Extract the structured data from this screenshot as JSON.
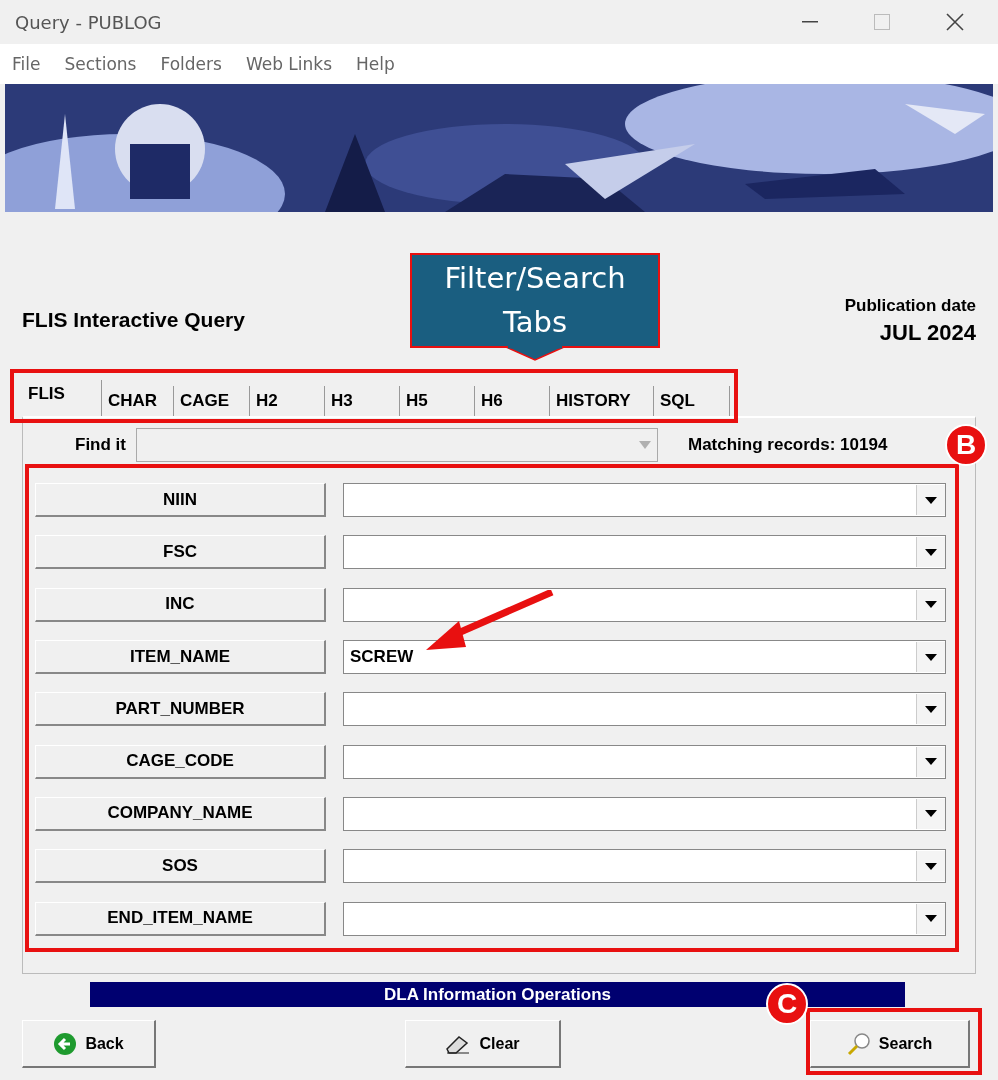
{
  "window": {
    "title": "Query - PUBLOG"
  },
  "menu": [
    "File",
    "Sections",
    "Folders",
    "Web Links",
    "Help"
  ],
  "heading": "FLIS Interactive Query",
  "publication": {
    "label": "Publication date",
    "date": "JUL 2024"
  },
  "tabs": [
    {
      "label": "FLIS",
      "selected": true
    },
    {
      "label": "CHAR",
      "selected": false
    },
    {
      "label": "CAGE",
      "selected": false
    },
    {
      "label": "H2",
      "selected": false
    },
    {
      "label": "H3",
      "selected": false
    },
    {
      "label": "H5",
      "selected": false
    },
    {
      "label": "H6",
      "selected": false
    },
    {
      "label": "HISTORY",
      "selected": false
    },
    {
      "label": "SQL",
      "selected": false
    }
  ],
  "find": {
    "label": "Find it",
    "disabled": true
  },
  "matching_records": "Matching records: 10194",
  "fields": [
    {
      "label": "NIIN"
    },
    {
      "label": "FSC"
    },
    {
      "label": "INC"
    },
    {
      "label": "ITEM_NAME",
      "value": "SCREW"
    },
    {
      "label": "PART_NUMBER"
    },
    {
      "label": "CAGE_CODE"
    },
    {
      "label": "COMPANY_NAME"
    },
    {
      "label": "SOS"
    },
    {
      "label": "END_ITEM_NAME"
    }
  ],
  "footer_banner": "DLA Information Operations",
  "buttons": [
    {
      "kind": "back",
      "label": "Back"
    },
    {
      "kind": "clear",
      "label": "Clear"
    },
    {
      "kind": "search",
      "label": "Search"
    }
  ],
  "annotations": {
    "callout": "Filter/Search Tabs",
    "markers": [
      "B",
      "C"
    ]
  }
}
